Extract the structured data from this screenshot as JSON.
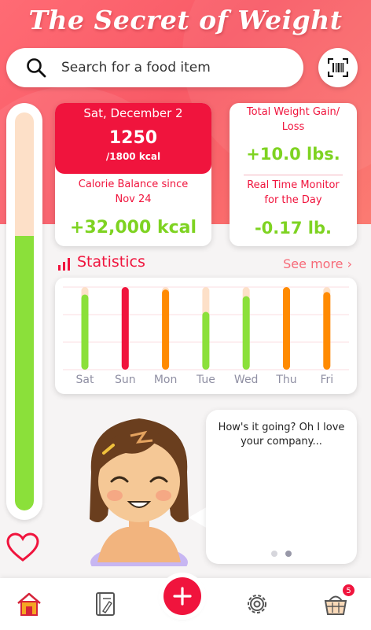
{
  "app": {
    "title": "The Secret of Weight"
  },
  "search": {
    "placeholder": "Search for a food item"
  },
  "calorie_gauge": {
    "fill_fraction": 0.69
  },
  "summary": {
    "date": "Sat, December 2",
    "calories": "1250",
    "goal": "/1800 kcal",
    "balance_label": "Calorie Balance since Nov 24",
    "balance_value": "+32,000 kcal",
    "weight_label": "Total Weight Gain/ Loss",
    "weight_value": "+10.0 lbs.",
    "monitor_label": "Real Time Monitor for the Day",
    "monitor_value": "-0.17 lb."
  },
  "statistics": {
    "title": "Statistics",
    "see_more": "See more",
    "days": [
      {
        "label": "Sat",
        "fill": 0.91,
        "color": "#8be03a"
      },
      {
        "label": "Sun",
        "fill": 1.0,
        "color": "#f0143d"
      },
      {
        "label": "Mon",
        "fill": 0.97,
        "color": "#ff8a00"
      },
      {
        "label": "Tue",
        "fill": 0.7,
        "color": "#8be03a"
      },
      {
        "label": "Wed",
        "fill": 0.89,
        "color": "#8be03a"
      },
      {
        "label": "Thu",
        "fill": 1.0,
        "color": "#ff8a00"
      },
      {
        "label": "Fri",
        "fill": 0.94,
        "color": "#ff8a00"
      }
    ],
    "track_color": "#fde0c8",
    "label_color": "#8f8fa3"
  },
  "assistant": {
    "message": "How's it going? Oh I love your company...",
    "page_count": 2,
    "active_page": 2
  },
  "nav": {
    "items": [
      "home-icon",
      "journal-icon",
      "add-icon",
      "settings-icon",
      "basket-icon"
    ],
    "badge_count": "5"
  },
  "colors": {
    "accent": "#f0143d",
    "green": "#7ed321",
    "orange": "#ff8a00"
  }
}
